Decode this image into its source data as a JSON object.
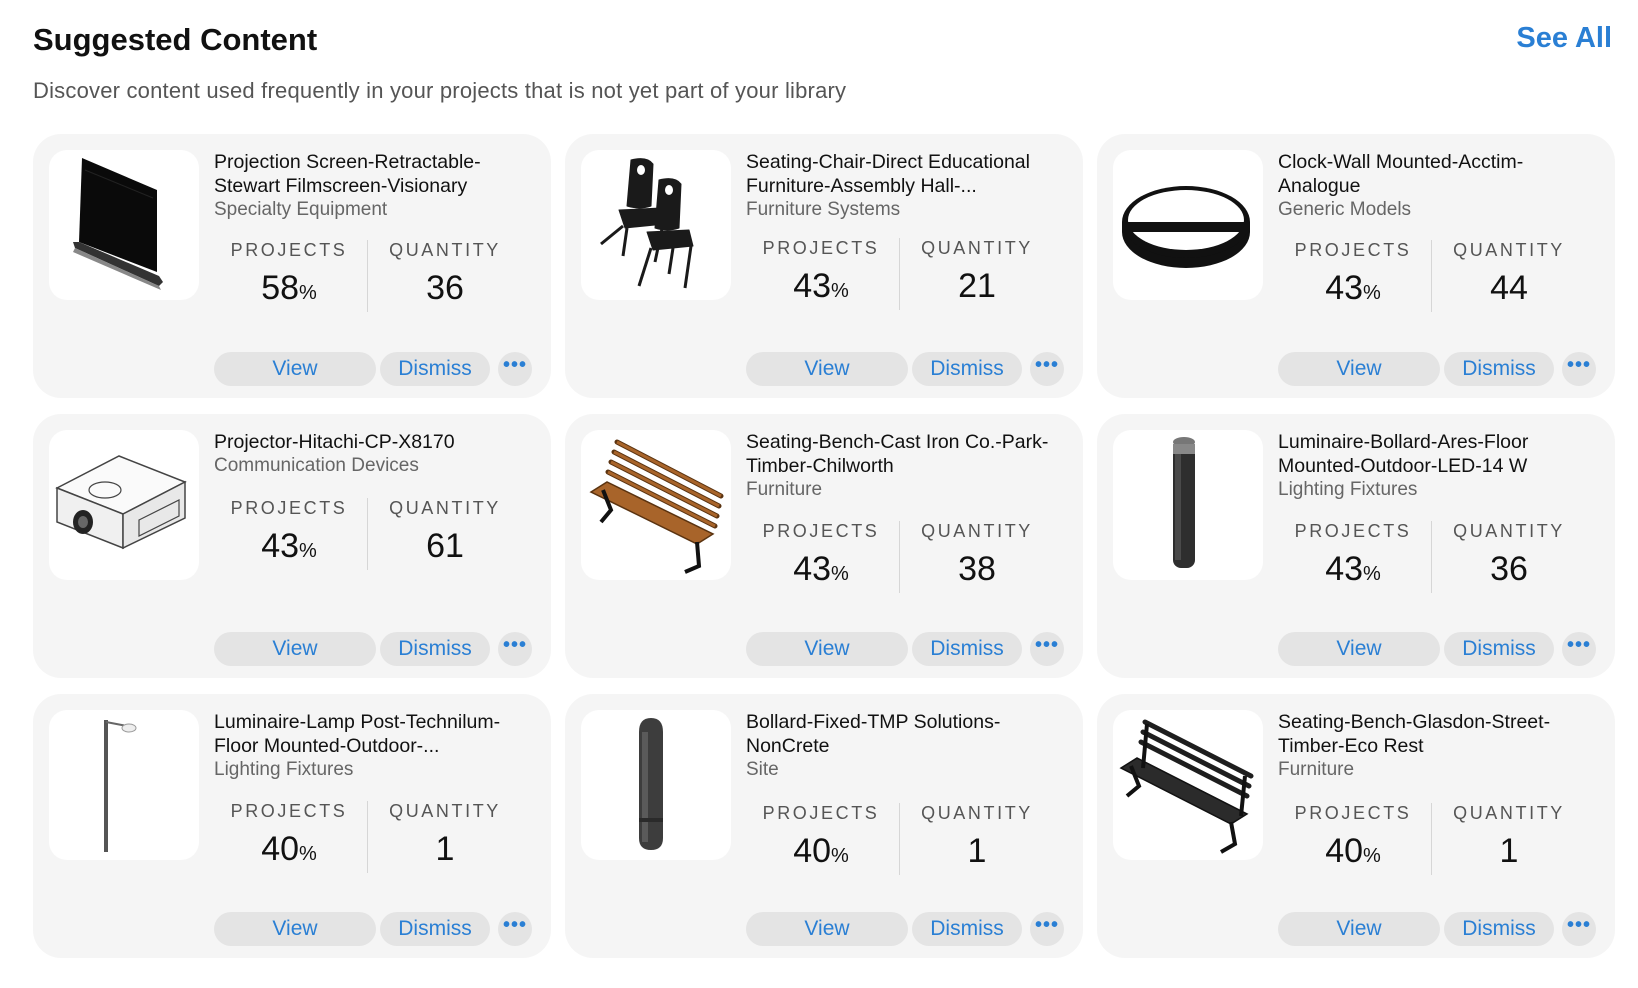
{
  "header": {
    "title": "Suggested Content",
    "see_all": "See All",
    "subtitle": "Discover content used frequently in your projects that is not yet part of your library"
  },
  "labels": {
    "projects": "PROJECTS",
    "quantity": "QUANTITY",
    "percent": "%",
    "view": "View",
    "dismiss": "Dismiss",
    "more": "•••"
  },
  "cards": [
    {
      "title": "Projection Screen-Retractable-Stewart Filmscreen-Visionary",
      "category": "Specialty Equipment",
      "projects": "58",
      "quantity": "36",
      "icon": "projection-screen"
    },
    {
      "title": "Seating-Chair-Direct Educational Furniture-Assembly Hall-...",
      "category": "Furniture Systems",
      "projects": "43",
      "quantity": "21",
      "icon": "chairs"
    },
    {
      "title": "Clock-Wall Mounted-Acctim-Analogue",
      "category": "Generic Models",
      "projects": "43",
      "quantity": "44",
      "icon": "wall-clock"
    },
    {
      "title": "Projector-Hitachi-CP-X8170",
      "category": "Communication Devices",
      "projects": "43",
      "quantity": "61",
      "icon": "projector"
    },
    {
      "title": "Seating-Bench-Cast Iron Co.-Park-Timber-Chilworth",
      "category": "Furniture",
      "projects": "43",
      "quantity": "38",
      "icon": "timber-bench"
    },
    {
      "title": "Luminaire-Bollard-Ares-Floor Mounted-Outdoor-LED-14 W",
      "category": "Lighting Fixtures",
      "projects": "43",
      "quantity": "36",
      "icon": "led-bollard"
    },
    {
      "title": "Luminaire-Lamp Post-Technilum-Floor Mounted-Outdoor-...",
      "category": "Lighting Fixtures",
      "projects": "40",
      "quantity": "1",
      "icon": "lamp-post"
    },
    {
      "title": "Bollard-Fixed-TMP Solutions-NonCrete",
      "category": "Site",
      "projects": "40",
      "quantity": "1",
      "icon": "bollard"
    },
    {
      "title": "Seating-Bench-Glasdon-Street-Timber-Eco Rest",
      "category": "Furniture",
      "projects": "40",
      "quantity": "1",
      "icon": "street-bench"
    }
  ],
  "colors": {
    "accent": "#2a7fd4",
    "card_bg": "#f5f5f5",
    "button_bg": "#e4e4e4"
  }
}
